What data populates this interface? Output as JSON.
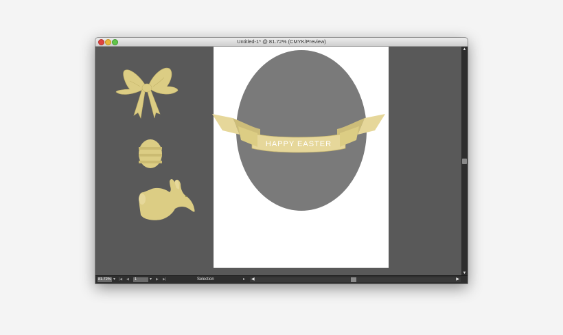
{
  "window": {
    "title": "Untitled-1* @ 81.72% (CMYK/Preview)"
  },
  "document": {
    "ribbon_text": "HAPPY EASTER"
  },
  "statusbar": {
    "zoom": "81.72%",
    "page": "1",
    "tool": "Selection",
    "first_arrow": "|◀",
    "prev_arrow": "◀",
    "next_arrow": "▶",
    "last_arrow": "▶|"
  },
  "colors": {
    "pasteboard": "#595959",
    "artboard": "#ffffff",
    "egg": "#7a7a7a",
    "ribbon": "#e6d79a",
    "ribbon_shadow": "#cdbd79",
    "art_gold": "#dccd84"
  },
  "icons": [
    "bow-icon",
    "egg-icon",
    "bunny-icon",
    "ribbon-banner"
  ]
}
